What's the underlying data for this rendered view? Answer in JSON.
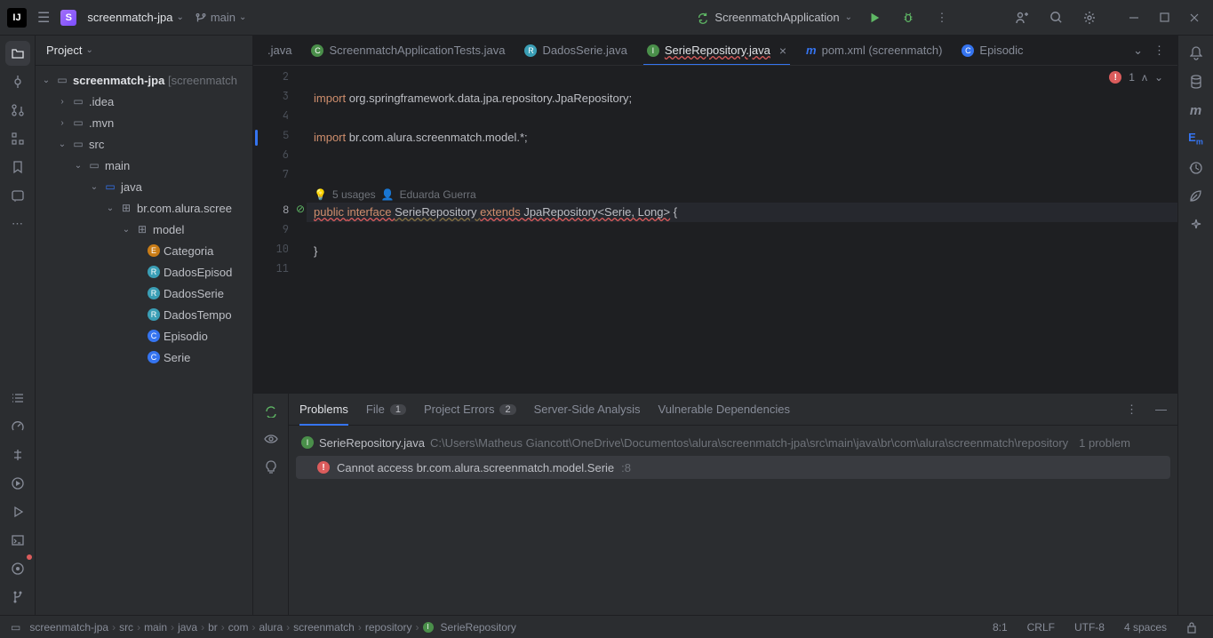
{
  "titlebar": {
    "project": "screenmatch-jpa",
    "branch": "main",
    "run_config": "ScreenmatchApplication"
  },
  "project_panel": {
    "title": "Project"
  },
  "tree": {
    "root": "screenmatch-jpa",
    "root_suffix": "[screenmatch",
    "idea": ".idea",
    "mvn": ".mvn",
    "src": "src",
    "main": "main",
    "java": "java",
    "pkg": "br.com.alura.scree",
    "model": "model",
    "files": {
      "categoria": "Categoria",
      "dadosEpisod": "DadosEpisod",
      "dadosSerie": "DadosSerie",
      "dadosTemp": "DadosTempo",
      "episodio": "Episodio",
      "serie": "Serie"
    }
  },
  "tabs": {
    "t0": ".java",
    "t1": "ScreenmatchApplicationTests.java",
    "t2": "DadosSerie.java",
    "t3": "SerieRepository.java",
    "t4": "pom.xml (screenmatch)",
    "t5": "Episodic"
  },
  "code": {
    "l3": "import org.springframework.data.jpa.repository.JpaRepository;",
    "l5_pre": "import ",
    "l5_pkg": "br.com.alura.screenmatch.model",
    "l5_post": ".*;",
    "hint_usages": "5 usages",
    "hint_author": "Eduarda Guerra",
    "l8_public": "public ",
    "l8_interface": "interface ",
    "l8_name": "SerieRepository ",
    "l8_extends": "extends ",
    "l8_repo": "JpaRepository",
    "l8_gen": "<Serie, Long>",
    "l8_brace": " {",
    "l10": "}",
    "err_count": "1"
  },
  "line_numbers": {
    "n2": "2",
    "n3": "3",
    "n4": "4",
    "n5": "5",
    "n6": "6",
    "n7": "7",
    "n8": "8",
    "n9": "9",
    "n10": "10",
    "n11": "11"
  },
  "problems": {
    "tab_problems": "Problems",
    "tab_file": "File",
    "tab_file_badge": "1",
    "tab_proj": "Project Errors",
    "tab_proj_badge": "2",
    "tab_server": "Server-Side Analysis",
    "tab_vuln": "Vulnerable Dependencies",
    "file_name": "SerieRepository.java",
    "file_path": "C:\\Users\\Matheus Giancott\\OneDrive\\Documentos\\alura\\screenmatch-jpa\\src\\main\\java\\br\\com\\alura\\screenmatch\\repository",
    "file_count": "1 problem",
    "err_msg": "Cannot access br.com.alura.screenmatch.model.Serie",
    "err_line": ":8"
  },
  "breadcrumb": [
    "screenmatch-jpa",
    "src",
    "main",
    "java",
    "br",
    "com",
    "alura",
    "screenmatch",
    "repository",
    "SerieRepository"
  ],
  "statusbar": {
    "pos": "8:1",
    "line_sep": "CRLF",
    "encoding": "UTF-8",
    "indent": "4 spaces"
  }
}
